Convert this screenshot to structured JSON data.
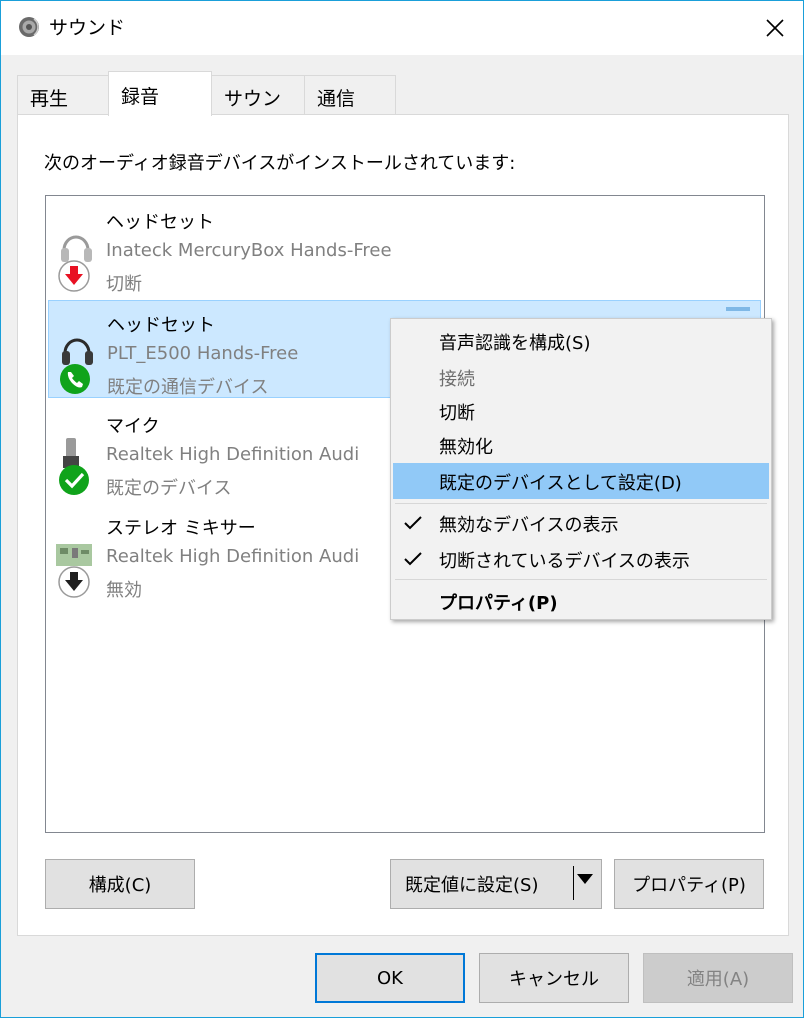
{
  "window": {
    "title": "サウンド"
  },
  "tabs": [
    {
      "label": "再生",
      "active": false
    },
    {
      "label": "録音",
      "active": true
    },
    {
      "label": "サウンド",
      "active": false
    },
    {
      "label": "通信",
      "active": false
    }
  ],
  "panel": {
    "instruction": "次のオーディオ録音デバイスがインストールされています:"
  },
  "devices": [
    {
      "name": "ヘッドセット",
      "description": "Inateck MercuryBox Hands-Free",
      "status": "切断",
      "icon": "headset-disconnected-icon"
    },
    {
      "name": "ヘッドセット",
      "description": "PLT_E500 Hands-Free",
      "status": "既定の通信デバイス",
      "icon": "headset-communication-icon",
      "selected": true
    },
    {
      "name": "マイク",
      "description": "Realtek High Definition Audi",
      "status": "既定のデバイス",
      "icon": "microphone-default-icon"
    },
    {
      "name": "ステレオ ミキサー",
      "description": "Realtek High Definition Audi",
      "status": "無効",
      "icon": "stereo-mixer-disabled-icon"
    }
  ],
  "context_menu": {
    "items": [
      {
        "label": "音声認識を構成(S)"
      },
      {
        "label": "接続",
        "disabled": true
      },
      {
        "label": "切断"
      },
      {
        "label": "無効化"
      },
      {
        "label": "既定のデバイスとして設定(D)",
        "highlighted": true
      },
      {
        "label": "無効なデバイスの表示",
        "checked": true
      },
      {
        "label": "切断されているデバイスの表示",
        "checked": true
      },
      {
        "label": "プロパティ(P)",
        "bold": true
      }
    ]
  },
  "panel_buttons": {
    "configure": "構成(C)",
    "set_default": "既定値に設定(S)",
    "properties": "プロパティ(P)"
  },
  "dialog_buttons": {
    "ok": "OK",
    "cancel": "キャンセル",
    "apply": "適用(A)"
  },
  "colors": {
    "accent": "#0078d7",
    "selection": "#cce8ff",
    "menu_highlight": "#91c9f7",
    "disconnected_badge": "#e81123",
    "default_badge": "#10a31b"
  }
}
